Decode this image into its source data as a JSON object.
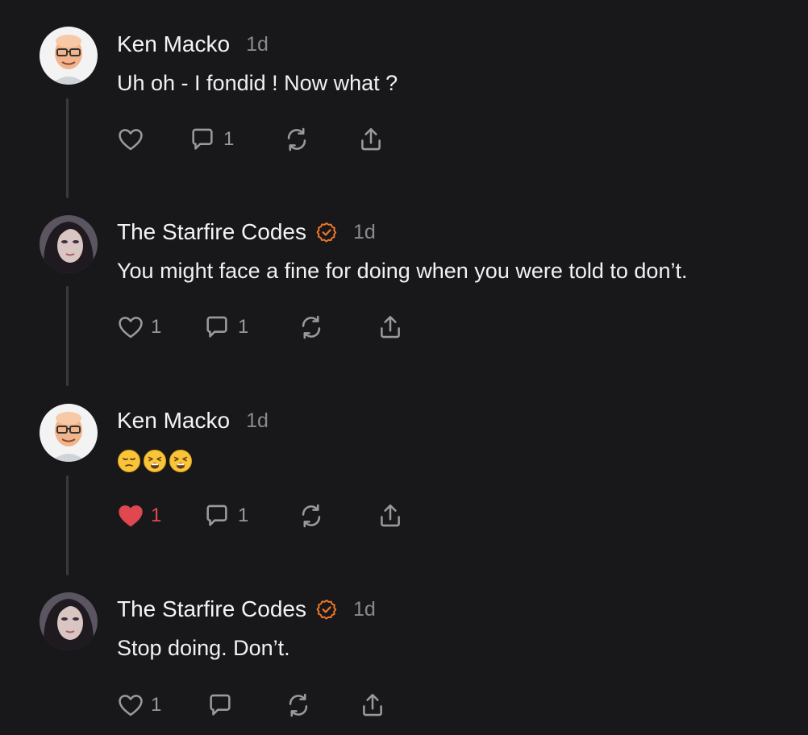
{
  "posts": [
    {
      "author": "Ken Macko",
      "time": "1d",
      "verified": false,
      "text": "Uh oh - I fondid ! Now what ?",
      "like_count": "",
      "liked": false,
      "reply_count": "1",
      "avatar": "ken-avatar"
    },
    {
      "author": "The Starfire Codes",
      "time": "1d",
      "verified": true,
      "text": "You might face a fine for doing when you were told to don’t.",
      "like_count": "1",
      "liked": false,
      "reply_count": "1",
      "avatar": "starfire-avatar"
    },
    {
      "author": "Ken Macko",
      "time": "1d",
      "verified": false,
      "text": "😔😩😩",
      "like_count": "1",
      "liked": true,
      "reply_count": "1",
      "avatar": "ken-avatar"
    },
    {
      "author": "The Starfire Codes",
      "time": "1d",
      "verified": true,
      "text": "Stop doing. Don’t.",
      "like_count": "1",
      "liked": false,
      "reply_count": "",
      "avatar": "starfire-avatar"
    }
  ],
  "colors": {
    "background": "#18181a",
    "verified_badge": "#f0782a",
    "liked_heart": "#e0474e",
    "icon_gray": "#9a9a9e",
    "thread_line": "#3a3a3c"
  },
  "icons": {
    "like": "heart-icon",
    "reply": "comment-icon",
    "repost": "repost-icon",
    "share": "share-icon",
    "verified": "verified-badge-icon"
  }
}
